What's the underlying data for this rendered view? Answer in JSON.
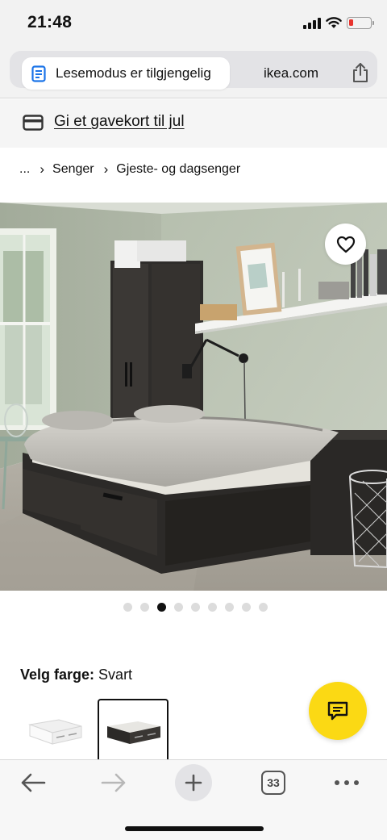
{
  "status_bar": {
    "time": "21:48",
    "battery_level": 0.2,
    "battery_color": "#e8332d"
  },
  "address_bar": {
    "reader_mode_text": "Lesemodus er tilgjengelig",
    "domain": "ikea.com",
    "icons": [
      "reader-mode-icon",
      "share-icon"
    ]
  },
  "promo": {
    "icon": "gift-card-icon",
    "link_text": "Gi et gavekort til jul"
  },
  "breadcrumb": {
    "items": [
      "...",
      "Senger",
      "Gjeste- og dagsenger"
    ],
    "separator": "›"
  },
  "product": {
    "image_alt": "Dagseng i svart-brun med skuffer i et soverom",
    "favorite_icon": "heart-icon",
    "carousel": {
      "total": 9,
      "active_index": 2
    },
    "color": {
      "label": "Velg farge:",
      "selected": "Svart",
      "swatches": [
        "hvit",
        "svart"
      ],
      "selected_index": 1
    }
  },
  "chat": {
    "icon": "chat-icon",
    "color": "#fbd914"
  },
  "toolbar": {
    "tab_count": "33",
    "icons": [
      "back-arrow-icon",
      "forward-arrow-icon",
      "plus-icon",
      "tabs-icon",
      "more-icon"
    ]
  }
}
